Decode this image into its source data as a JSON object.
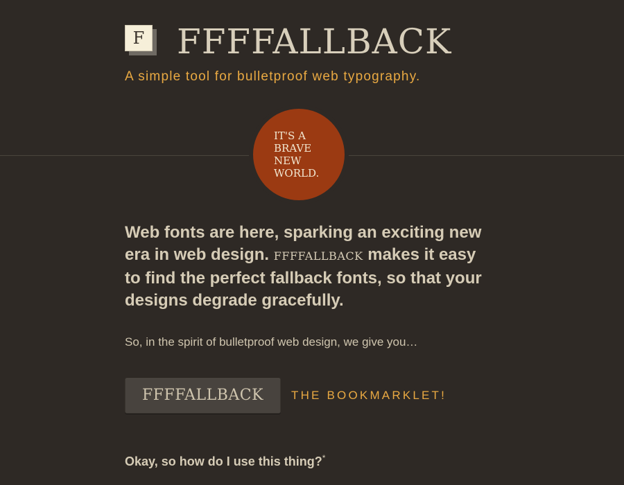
{
  "header": {
    "logo_letter": "F",
    "title": "FFFFALLBACK",
    "tagline": "A simple tool for bulletproof web typography."
  },
  "badge": {
    "text": "IT'S A BRAVE NEW WORLD."
  },
  "intro": {
    "part1": "Web fonts are here, sparking an exciting new era in web design.",
    "brand": "FFFFALLBACK",
    "part2": "makes it easy to find the perfect fallback fonts, so that your designs degrade gracefully."
  },
  "spirit": "So, in the spirit of bulletproof web design, we give you…",
  "bookmarklet": {
    "button_label": "FFFFALLBACK",
    "caption": "THE BOOKMARKLET!"
  },
  "question": {
    "text": "Okay, so how do I use this thing?",
    "footnote_mark": "*"
  },
  "colors": {
    "background": "#2e2925",
    "accent": "#e9a942",
    "badge": "#9b3a12",
    "text": "#d6ccb6"
  }
}
